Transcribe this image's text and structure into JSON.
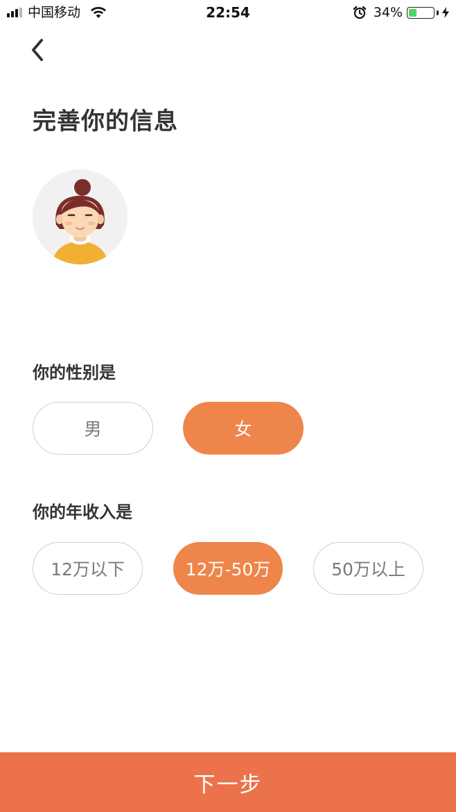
{
  "status_bar": {
    "carrier": "中国移动",
    "time": "22:54",
    "battery_percent": "34%",
    "battery_level": 0.34,
    "battery_color": "#4cd964",
    "icons": [
      "signal-icon",
      "wifi-icon",
      "alarm-icon",
      "battery-icon",
      "charging-bolt-icon"
    ]
  },
  "nav": {
    "back_icon": "chevron-left-icon"
  },
  "page": {
    "title": "完善你的信息"
  },
  "avatar": {
    "description_icon": "girl-avatar-icon"
  },
  "gender": {
    "label": "你的性别是",
    "options": [
      {
        "label": "男",
        "selected": false
      },
      {
        "label": "女",
        "selected": true
      }
    ]
  },
  "income": {
    "label": "你的年收入是",
    "options": [
      {
        "label": "12万以下",
        "selected": false
      },
      {
        "label": "12万-50万",
        "selected": true
      },
      {
        "label": "50万以上",
        "selected": false
      }
    ]
  },
  "footer": {
    "next_label": "下一步"
  },
  "colors": {
    "accent": "#ee854a",
    "next_button": "#ec724b",
    "title_text": "#333333",
    "unselected_text": "#7a7a7a",
    "unselected_border": "#cfcfcf"
  }
}
